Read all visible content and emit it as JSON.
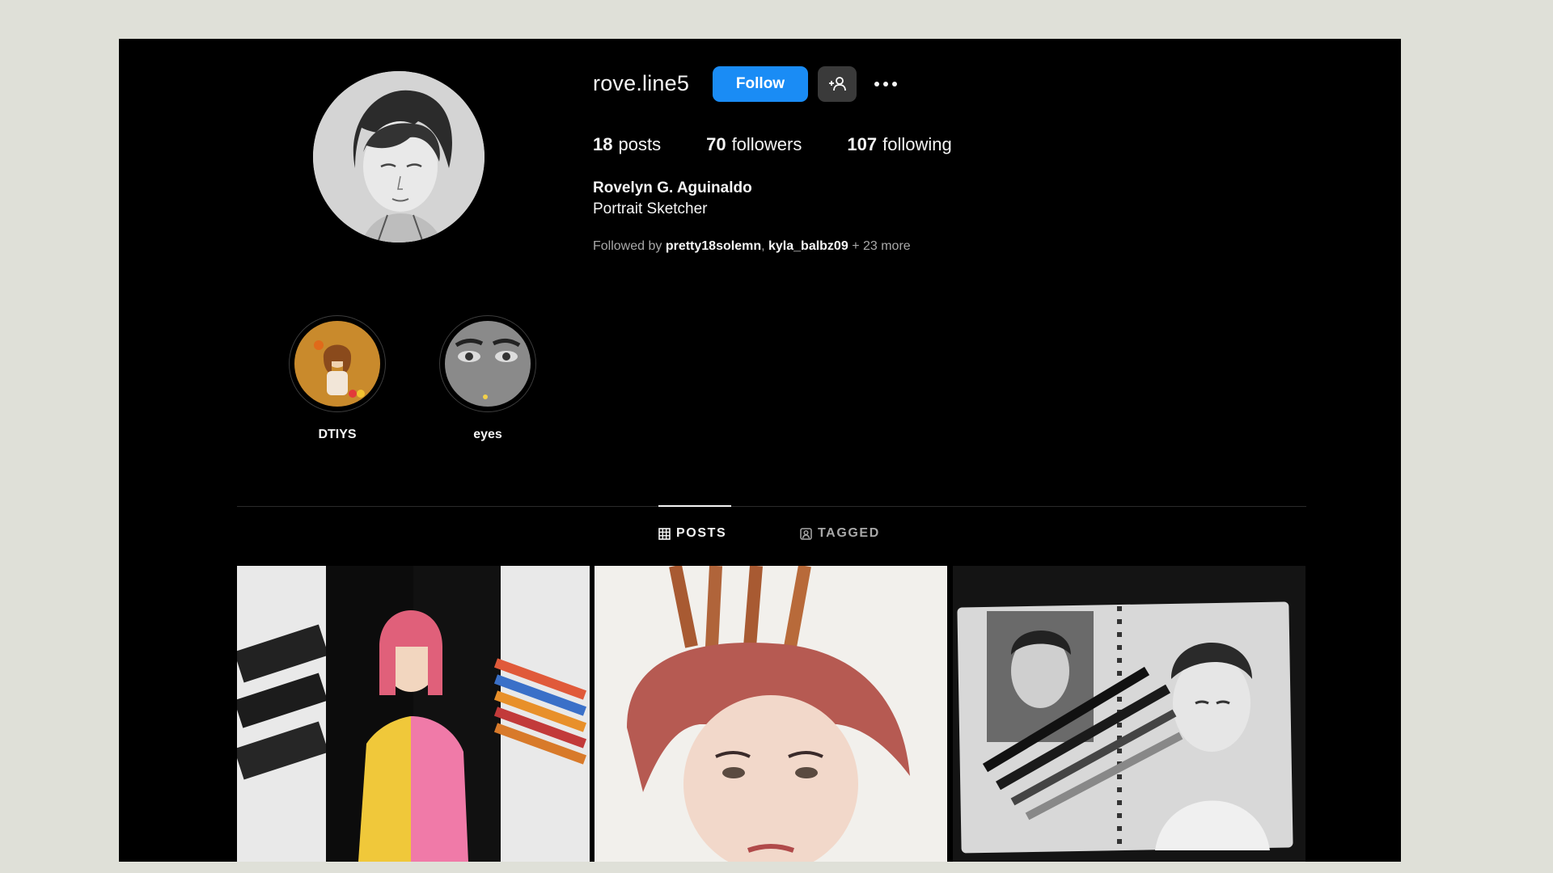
{
  "profile": {
    "username": "rove.line5",
    "follow_label": "Follow",
    "full_name": "Rovelyn G. Aguinaldo",
    "bio": "Portrait Sketcher"
  },
  "stats": {
    "posts_count": "18",
    "posts_label": "posts",
    "followers_count": "70",
    "followers_label": "followers",
    "following_count": "107",
    "following_label": "following"
  },
  "followed_by": {
    "prefix": "Followed by",
    "user1": "pretty18solemn",
    "sep": ",",
    "user2": "kyla_balbz09",
    "more": "+ 23 more"
  },
  "highlights": [
    {
      "label": "DTIYS"
    },
    {
      "label": "eyes"
    }
  ],
  "tabs": [
    {
      "label": "POSTS",
      "active": true
    },
    {
      "label": "TAGGED",
      "active": false
    }
  ],
  "colors": {
    "background": "#000000",
    "follow_button": "#1a8cf5",
    "secondary_button": "#3a3a3a",
    "muted_text": "#a8a8a8",
    "page_margin": "#dfe0d8"
  },
  "icons": {
    "suggest": "person-add-icon",
    "more": "more-options-icon",
    "posts_tab": "grid-icon",
    "tagged_tab": "tagged-person-icon"
  }
}
